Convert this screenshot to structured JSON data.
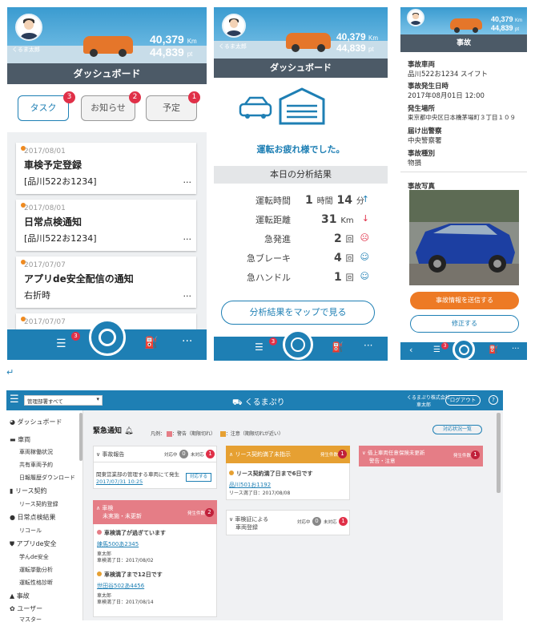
{
  "phone1": {
    "points1": "40,379",
    "unit1": "Km",
    "points2": "44,839",
    "unit2": "pt",
    "user": "くるま太郎",
    "title": "ダッシュボード",
    "tabs": [
      {
        "label": "タスク",
        "badge": "3"
      },
      {
        "label": "お知らせ",
        "badge": "2"
      },
      {
        "label": "予定",
        "badge": "1"
      }
    ],
    "cards": [
      {
        "date": "2017/08/01",
        "title": "車検予定登録",
        "sub": "[品川522お1234]",
        "more": "..."
      },
      {
        "date": "2017/08/01",
        "title": "日常点検通知",
        "sub": "[品川522お1234]",
        "more": "..."
      },
      {
        "date": "2017/07/07",
        "title": "アプリde安全配信の通知",
        "sub": "右折時",
        "more": "..."
      },
      {
        "date": "2017/07/07"
      }
    ],
    "nav_badge": "3"
  },
  "phone2": {
    "points1": "40,379",
    "unit1": "Km",
    "points2": "44,839",
    "unit2": "pt",
    "user": "くるま太郎",
    "title": "ダッシュボード",
    "message": "運転お疲れ様でした。",
    "section": "本日の分析結果",
    "rows": [
      {
        "label": "運転時間",
        "value": "1",
        "unit": "時間",
        "value2": "14",
        "unit2": "分",
        "icon": "↑"
      },
      {
        "label": "運転距離",
        "value": "31",
        "unit": "Km",
        "icon": "↓"
      },
      {
        "label": "急発進",
        "value": "2",
        "unit": "回",
        "icon": "☹"
      },
      {
        "label": "急ブレーキ",
        "value": "4",
        "unit": "回",
        "icon": "☺"
      },
      {
        "label": "急ハンドル",
        "value": "1",
        "unit": "回",
        "icon": "☺"
      }
    ],
    "map_button": "分析結果をマップで見る",
    "nav_badge": "3"
  },
  "phone3": {
    "points1": "40,379",
    "unit1": "Km",
    "points2": "44,839",
    "unit2": "pt",
    "title": "事故",
    "fields": [
      {
        "label": "事故車両",
        "value": "品川522お1234 スイフト"
      },
      {
        "label": "事故発生日時",
        "value": "2017年08月01日 12:00"
      },
      {
        "label": "発生場所",
        "value": "東京都中央区日本橋茅場町３丁目１０９"
      },
      {
        "label": "届け出警察",
        "value": "中央警察署"
      },
      {
        "label": "事故種別",
        "value": "物損"
      },
      {
        "label": "事故写真",
        "value": ""
      }
    ],
    "send_button": "事故情報を送信する",
    "edit_button": "修正する",
    "nav_badge": "3"
  },
  "return_mark": "↵",
  "desktop": {
    "filter": "管理部署すべて",
    "logo": "くるまぷり",
    "company": "くるまぷり株式会社",
    "user": "車太郎",
    "logout": "ログアウト",
    "help": "?",
    "sidebar": [
      {
        "label": "ダッシュボード",
        "level": 0
      },
      {
        "label": "車両",
        "level": 0
      },
      {
        "label": "車両稼働状況",
        "level": 1
      },
      {
        "label": "共有車両予約",
        "level": 1
      },
      {
        "label": "日報履歴ダウンロード",
        "level": 1
      },
      {
        "label": "リース契約",
        "level": 0
      },
      {
        "label": "リース契約登録",
        "level": 1
      },
      {
        "label": "日常点検結果",
        "level": 0
      },
      {
        "label": "リコール",
        "level": 1
      },
      {
        "label": "アプリde安全",
        "level": 0
      },
      {
        "label": "学んde安全",
        "level": 1
      },
      {
        "label": "運転挙動分析",
        "level": 1
      },
      {
        "label": "運転性格診断",
        "level": 1
      },
      {
        "label": "事故",
        "level": 0
      },
      {
        "label": "ユーザー",
        "level": 0
      },
      {
        "label": "マスター",
        "level": 1
      }
    ],
    "urgent_title": "緊急通知",
    "legend_label": "凡例：",
    "legend_red": "：警告（期限切れ）",
    "legend_orange": "：注意（期限切れが近い）",
    "status_button": "対応状況一覧",
    "accident": {
      "title": "事故報告",
      "c1": "対応中",
      "n1": "0",
      "c2": "未対応",
      "n2": "1",
      "text": "関東営業部の管理する車両にて発生",
      "link": "2017/07/31 10:25",
      "action": "対応する"
    },
    "inspection": {
      "title": "車検",
      "subtitle": "未実施・未更新",
      "count_label": "発生件数",
      "count": "2",
      "items": [
        {
          "heading": "車検満了が過ぎています",
          "link": "練馬500あ2345",
          "user": "車太郎",
          "date": "車検満了日：2017/08/02"
        },
        {
          "heading": "車検満了まで12日です",
          "link": "世田谷502あ4456",
          "user": "車太郎",
          "date": "車検満了日：2017/08/14"
        }
      ]
    },
    "lease": {
      "title": "リース契約満了未指示",
      "count_label": "発生件数",
      "count": "1",
      "heading": "リース契約満了日まで6日です",
      "link": "品川501お1192",
      "date": "リース満了日：2017/08/08"
    },
    "registration": {
      "title": "車検証による",
      "title2": "車両登録",
      "c1": "対応中",
      "n1": "0",
      "c2": "未対応",
      "n2": "1"
    },
    "insurance": {
      "title": "借上車両任意保険未更新",
      "subtitle": "警告・注意",
      "count_label": "発生件数",
      "count": "1"
    }
  }
}
